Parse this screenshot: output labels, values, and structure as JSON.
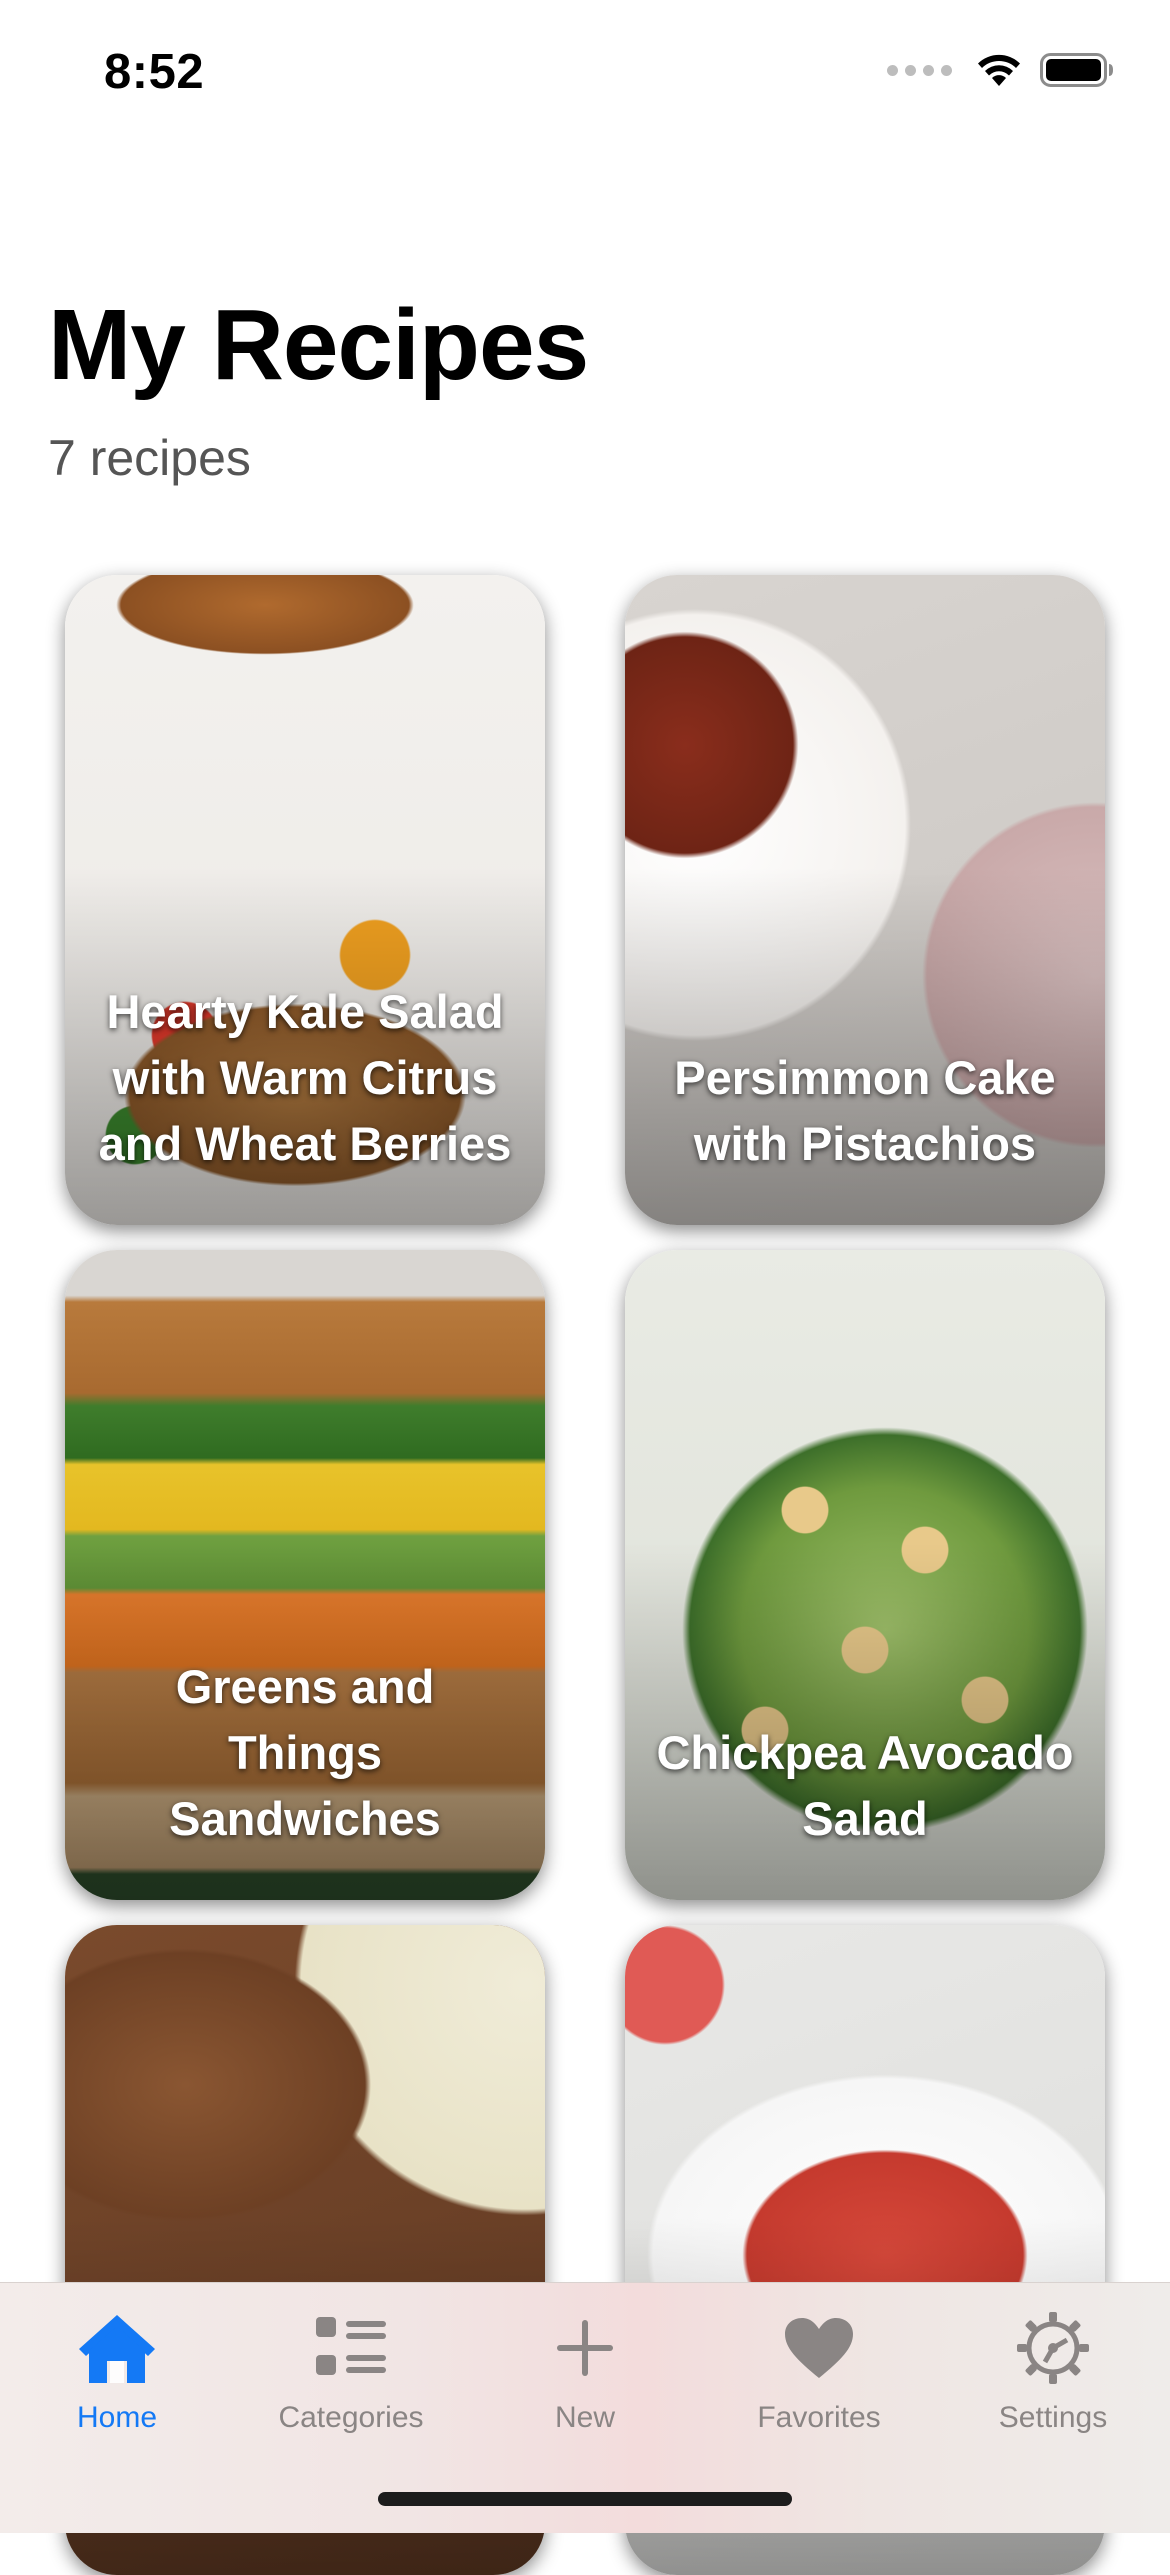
{
  "status_bar": {
    "time": "8:52"
  },
  "header": {
    "title": "My Recipes",
    "subtitle": "7 recipes"
  },
  "recipes": [
    {
      "title": "Hearty Kale Salad with Warm Citrus and Wheat Berries"
    },
    {
      "title": "Persimmon Cake with Pistachios"
    },
    {
      "title": "Greens and Things Sandwiches"
    },
    {
      "title": "Chickpea Avocado Salad"
    },
    {
      "title": ""
    },
    {
      "title": ""
    }
  ],
  "tab_bar": {
    "tabs": [
      {
        "label": "Home",
        "icon": "house-icon",
        "active": true
      },
      {
        "label": "Categories",
        "icon": "list-icon",
        "active": false
      },
      {
        "label": "New",
        "icon": "plus-icon",
        "active": false
      },
      {
        "label": "Favorites",
        "icon": "heart-icon",
        "active": false
      },
      {
        "label": "Settings",
        "icon": "gear-icon",
        "active": false
      }
    ]
  },
  "colors": {
    "accent": "#1479f5",
    "inactive_tab": "#8a8584",
    "subtitle": "#555555"
  }
}
